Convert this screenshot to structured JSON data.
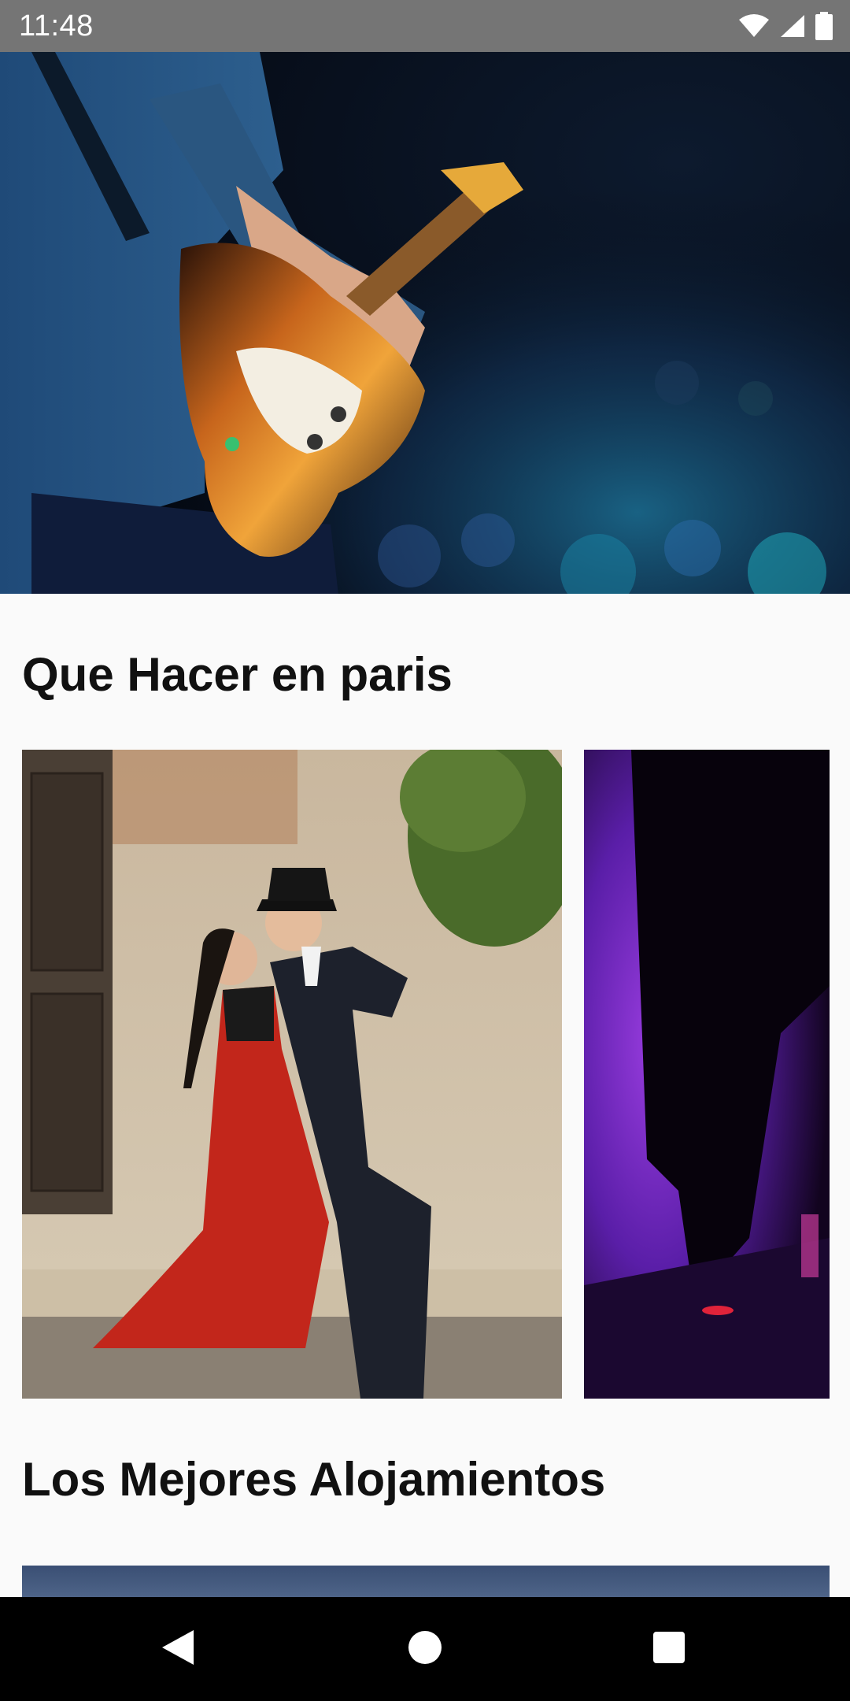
{
  "status_bar": {
    "time": "11:48",
    "icons": [
      "wifi-icon",
      "cell-signal-icon",
      "battery-icon"
    ]
  },
  "hero": {
    "image": "guitarist-on-stage-photo"
  },
  "sections": [
    {
      "title": "Que Hacer en paris",
      "cards": [
        {
          "image": "tango-dancers-photo"
        },
        {
          "image": "concert-purple-lights-photo"
        }
      ]
    },
    {
      "title": "Los Mejores Alojamientos",
      "cards": [
        {
          "image": "accommodation-photo"
        }
      ]
    }
  ],
  "nav_bar": {
    "buttons": [
      "back-icon",
      "home-icon",
      "recents-icon"
    ]
  },
  "colors": {
    "status_bar": "#757575",
    "background": "#fafafa",
    "title_text": "#111111",
    "nav_bar": "#000000"
  }
}
